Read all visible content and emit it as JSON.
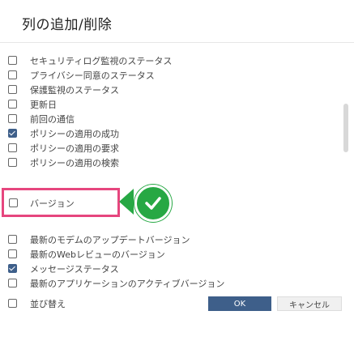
{
  "dialog": {
    "title": "列の追加/削除"
  },
  "columns": [
    {
      "label": "セキュリティログ監視のステータス",
      "checked": false
    },
    {
      "label": "プライバシー同意のステータス",
      "checked": false
    },
    {
      "label": "保護監視のステータス",
      "checked": false
    },
    {
      "label": "更新日",
      "checked": false
    },
    {
      "label": "前回の通信",
      "checked": false
    },
    {
      "label": "ポリシーの適用の成功",
      "checked": true
    },
    {
      "label": "ポリシーの適用の要求",
      "checked": false
    },
    {
      "label": "ポリシーの適用の検索",
      "checked": false
    },
    {
      "label": "バージョン",
      "checked": false
    },
    {
      "label": "最新のモデムのアップデートバージョン",
      "checked": false
    },
    {
      "label": "最新のWebレビューのバージョン",
      "checked": false
    },
    {
      "label": "メッセージステータス",
      "checked": true
    },
    {
      "label": "最新のアプリケーションのアクティブバージョン",
      "checked": false
    }
  ],
  "footer": {
    "sort_label": "並び替え",
    "ok_label": "OK",
    "cancel_label": "キャンセル"
  },
  "colors": {
    "accent": "#3e5f8a",
    "highlight": "#e6467e",
    "check": "#27a844"
  }
}
